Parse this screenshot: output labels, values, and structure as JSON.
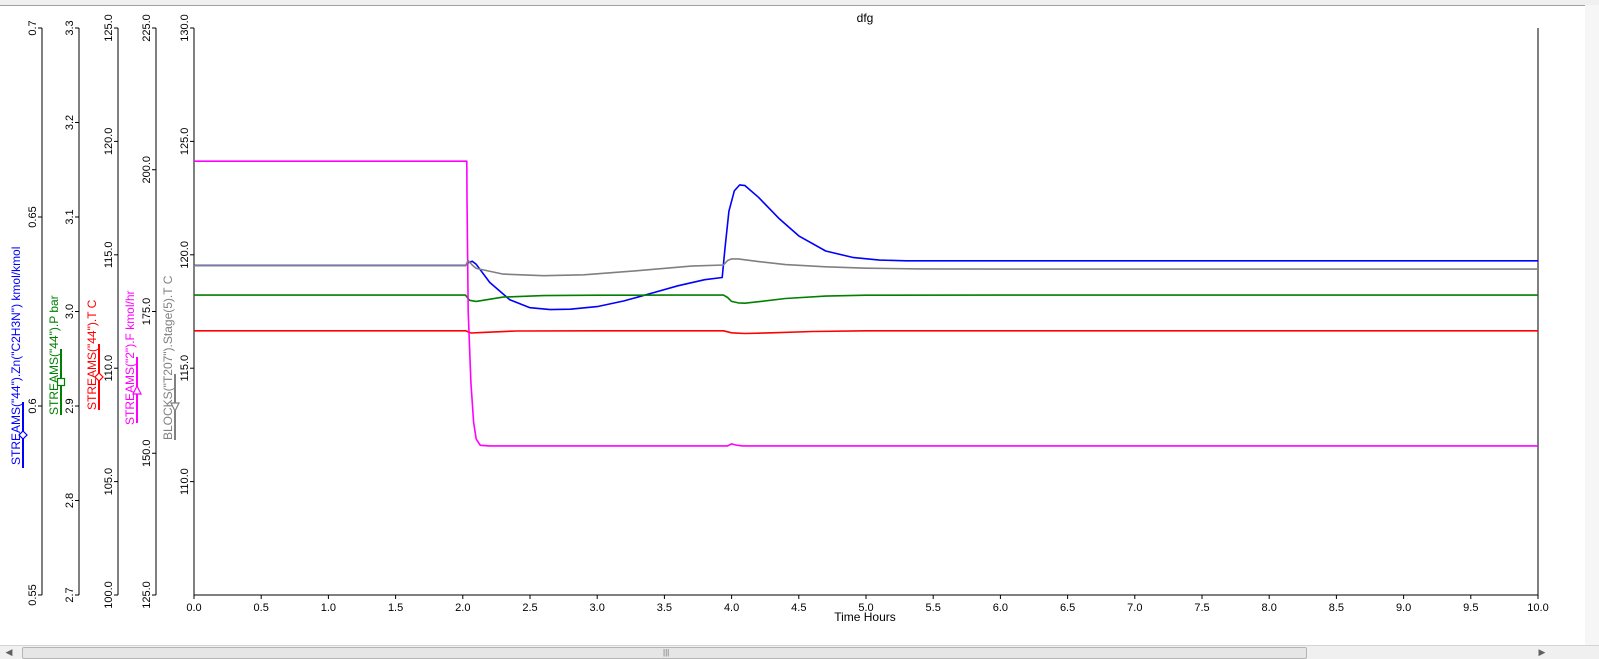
{
  "chart_data": {
    "type": "line",
    "title": "dfg",
    "xlabel": "Time Hours",
    "xlim": [
      0,
      10
    ],
    "xticks": [
      "0.0",
      "0.5",
      "1.0",
      "1.5",
      "2.0",
      "2.5",
      "3.0",
      "3.5",
      "4.0",
      "4.5",
      "5.0",
      "5.5",
      "6.0",
      "6.5",
      "7.0",
      "7.5",
      "8.0",
      "8.5",
      "9.0",
      "9.5",
      "10.0"
    ],
    "grid": false,
    "axes": [
      {
        "name": "STREAMS(\"44\").Zn(\"C2H3N\") kmol/kmol",
        "color": "#0000ff",
        "marker": "diamond",
        "ylim": [
          0.55,
          0.7
        ],
        "ticks": [
          "0.55",
          "0.6",
          "0.65",
          "0.7"
        ]
      },
      {
        "name": "STREAMS(\"44\").P bar",
        "color": "#008000",
        "marker": "square",
        "ylim": [
          2.7,
          3.3
        ],
        "ticks": [
          "2.7",
          "2.8",
          "2.9",
          "3.0",
          "3.1",
          "3.2",
          "3.3"
        ]
      },
      {
        "name": "STREAMS(\"44\").T C",
        "color": "#ff0000",
        "marker": "diamond",
        "ylim": [
          100.0,
          125.0
        ],
        "ticks": [
          "100.0",
          "105.0",
          "110.0",
          "115.0",
          "120.0",
          "125.0"
        ]
      },
      {
        "name": "STREAMS(\"2\").F kmol/hr",
        "color": "#ff00ff",
        "marker": "triangle-up",
        "ylim": [
          125.0,
          225.0
        ],
        "ticks": [
          "125.0",
          "150.0",
          "175.0",
          "200.0",
          "225.0"
        ]
      },
      {
        "name": "BLOCKS(\"T207\").Stage(5).T C",
        "color": "#808080",
        "marker": "triangle-down",
        "ylim": [
          105.0,
          130.0
        ],
        "ticks": [
          "110.0",
          "115.0",
          "120.0",
          "125.0",
          "130.0"
        ]
      }
    ],
    "series": [
      {
        "name": "STREAMS(\"44\").Zn(\"C2H3N\") kmol/kmol",
        "axis": 0,
        "x": [
          0,
          2.02,
          2.04,
          2.07,
          2.1,
          2.2,
          2.35,
          2.5,
          2.65,
          2.8,
          3.0,
          3.2,
          3.4,
          3.6,
          3.8,
          3.93,
          3.95,
          3.98,
          4.02,
          4.06,
          4.1,
          4.2,
          4.35,
          4.5,
          4.7,
          4.9,
          5.1,
          5.3,
          5.5,
          6,
          7,
          8,
          9,
          10
        ],
        "y": [
          0.6372,
          0.6372,
          0.6379,
          0.6383,
          0.6375,
          0.6327,
          0.6281,
          0.626,
          0.6255,
          0.6256,
          0.6263,
          0.6278,
          0.6298,
          0.6318,
          0.6334,
          0.634,
          0.6415,
          0.6515,
          0.6569,
          0.6585,
          0.6583,
          0.6552,
          0.6497,
          0.645,
          0.641,
          0.6393,
          0.6386,
          0.6384,
          0.6384,
          0.6384,
          0.6384,
          0.6384,
          0.6384,
          0.6384
        ]
      },
      {
        "name": "STREAMS(\"44\").P bar",
        "axis": 1,
        "x": [
          0,
          2.02,
          2.05,
          2.1,
          2.3,
          2.6,
          3.0,
          3.5,
          3.94,
          3.97,
          4.0,
          4.05,
          4.1,
          4.2,
          4.4,
          4.7,
          5.0,
          6,
          7,
          8,
          9,
          10
        ],
        "y": [
          3.0174,
          3.0174,
          3.0118,
          3.0107,
          3.0152,
          3.0168,
          3.0172,
          3.0174,
          3.0174,
          3.0148,
          3.0107,
          3.0091,
          3.0088,
          3.0104,
          3.0138,
          3.0163,
          3.0172,
          3.0174,
          3.0174,
          3.0174,
          3.0174,
          3.0174
        ]
      },
      {
        "name": "STREAMS(\"44\").T C",
        "axis": 2,
        "x": [
          0,
          2.02,
          2.06,
          2.15,
          2.4,
          3.0,
          3.94,
          4.0,
          4.1,
          4.3,
          4.6,
          5.0,
          6,
          7,
          8,
          9,
          10
        ],
        "y": [
          111.65,
          111.65,
          111.55,
          111.58,
          111.64,
          111.65,
          111.65,
          111.56,
          111.53,
          111.56,
          111.62,
          111.65,
          111.65,
          111.65,
          111.65,
          111.65,
          111.65
        ]
      },
      {
        "name": "STREAMS(\"2\").F kmol/hr",
        "axis": 3,
        "x": [
          0,
          2.03,
          2.031,
          2.04,
          2.06,
          2.08,
          2.1,
          2.13,
          2.2,
          3.94,
          3.97,
          4.0,
          4.03,
          4.08,
          4.2,
          5,
          6,
          7,
          8,
          9,
          10
        ],
        "y": [
          201.5,
          201.5,
          195.0,
          175.0,
          162.5,
          155.5,
          152.5,
          151.4,
          151.3,
          151.3,
          151.3,
          151.65,
          151.45,
          151.3,
          151.3,
          151.3,
          151.3,
          151.3,
          151.3,
          151.3,
          151.3
        ]
      },
      {
        "name": "BLOCKS(\"T207\").Stage(5).T C",
        "axis": 4,
        "x": [
          0,
          2.02,
          2.04,
          2.07,
          2.1,
          2.3,
          2.6,
          2.9,
          3.3,
          3.7,
          3.94,
          3.97,
          4.0,
          4.05,
          4.1,
          4.2,
          4.4,
          4.7,
          5.0,
          5.4,
          6,
          7,
          8,
          9,
          10
        ],
        "y": [
          119.52,
          119.52,
          119.75,
          119.55,
          119.4,
          119.15,
          119.08,
          119.12,
          119.3,
          119.5,
          119.55,
          119.75,
          119.82,
          119.82,
          119.78,
          119.7,
          119.57,
          119.47,
          119.41,
          119.38,
          119.37,
          119.37,
          119.37,
          119.37,
          119.37
        ]
      }
    ]
  }
}
